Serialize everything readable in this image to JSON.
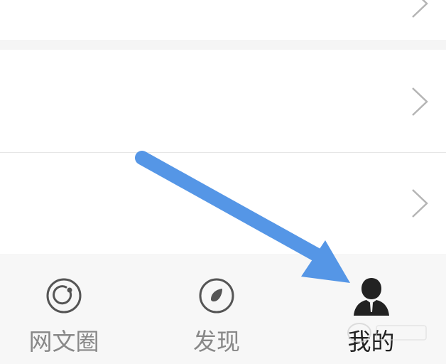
{
  "tabs": [
    {
      "label": "网文圈",
      "icon": "circle-ring-icon",
      "active": false
    },
    {
      "label": "发现",
      "icon": "discover-icon",
      "active": false
    },
    {
      "label": "我的",
      "icon": "profile-icon",
      "active": true
    }
  ],
  "annotation": {
    "arrow_color": "#5596e6",
    "target": "我的"
  },
  "colors": {
    "inactive": "#888888",
    "active": "#222222",
    "background": "#f5f5f5"
  }
}
